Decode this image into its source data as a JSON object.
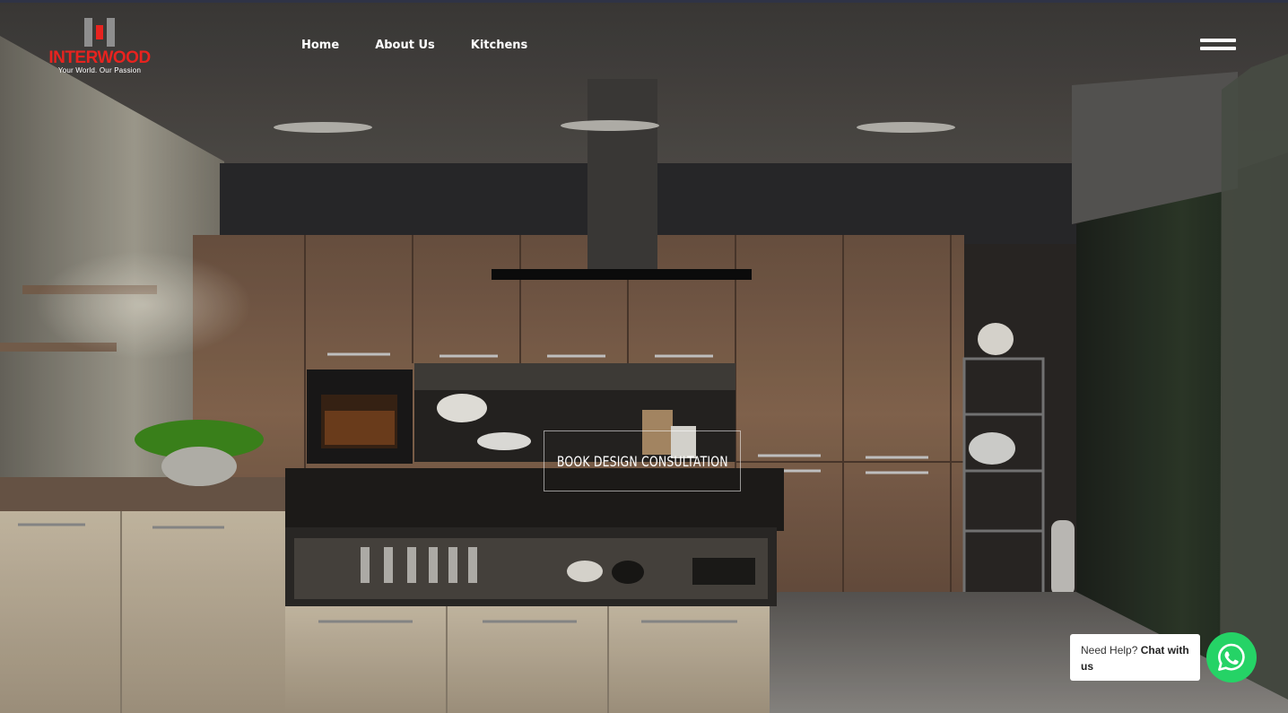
{
  "brand": {
    "name": "INTERWOOD",
    "tagline": "Your World. Our Passion",
    "accent": "#e8231f"
  },
  "nav": {
    "items": [
      {
        "label": "Home"
      },
      {
        "label": "About Us"
      },
      {
        "label": "Kitchens"
      }
    ]
  },
  "menu": {
    "icon": "hamburger-menu-icon"
  },
  "hero": {
    "cta_label": "BOOK DESIGN CONSULTATION"
  },
  "help_widget": {
    "prefix": "Need Help?",
    "emphasis": "Chat with us",
    "icon": "whatsapp-icon",
    "color": "#25d366"
  }
}
